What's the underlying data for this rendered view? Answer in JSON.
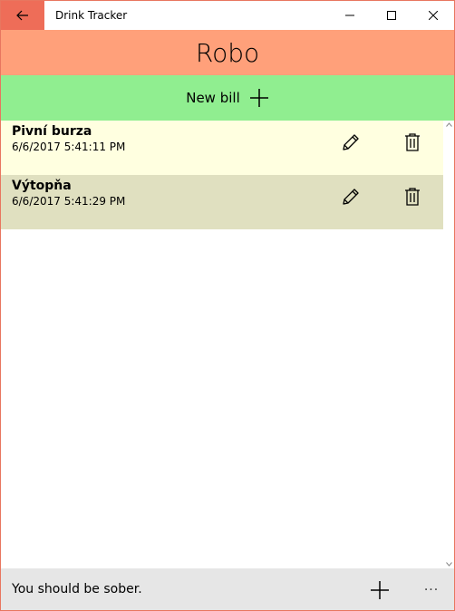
{
  "window": {
    "title": "Drink Tracker",
    "back_icon": "back-arrow-icon",
    "controls": [
      "minimize-icon",
      "maximize-icon",
      "close-icon"
    ]
  },
  "header": {
    "title": "Robo"
  },
  "new_bill": {
    "label": "New bill",
    "icon": "plus-icon"
  },
  "bills": [
    {
      "name": "Pivní burza",
      "date": "6/6/2017 5:41:11 PM",
      "background": "#ffffe0"
    },
    {
      "name": "Výtopňa",
      "date": "6/6/2017 5:41:29 PM",
      "background": "#e0e0c0"
    }
  ],
  "bottom_bar": {
    "status": "You should be sober.",
    "add_icon": "plus-icon",
    "more_icon": "more-icon",
    "more_text": "···"
  },
  "colors": {
    "accent": "#ee6d58",
    "header": "#ffa07a",
    "new_bill": "#90ee90",
    "bottom_bar": "#e6e6e6"
  }
}
